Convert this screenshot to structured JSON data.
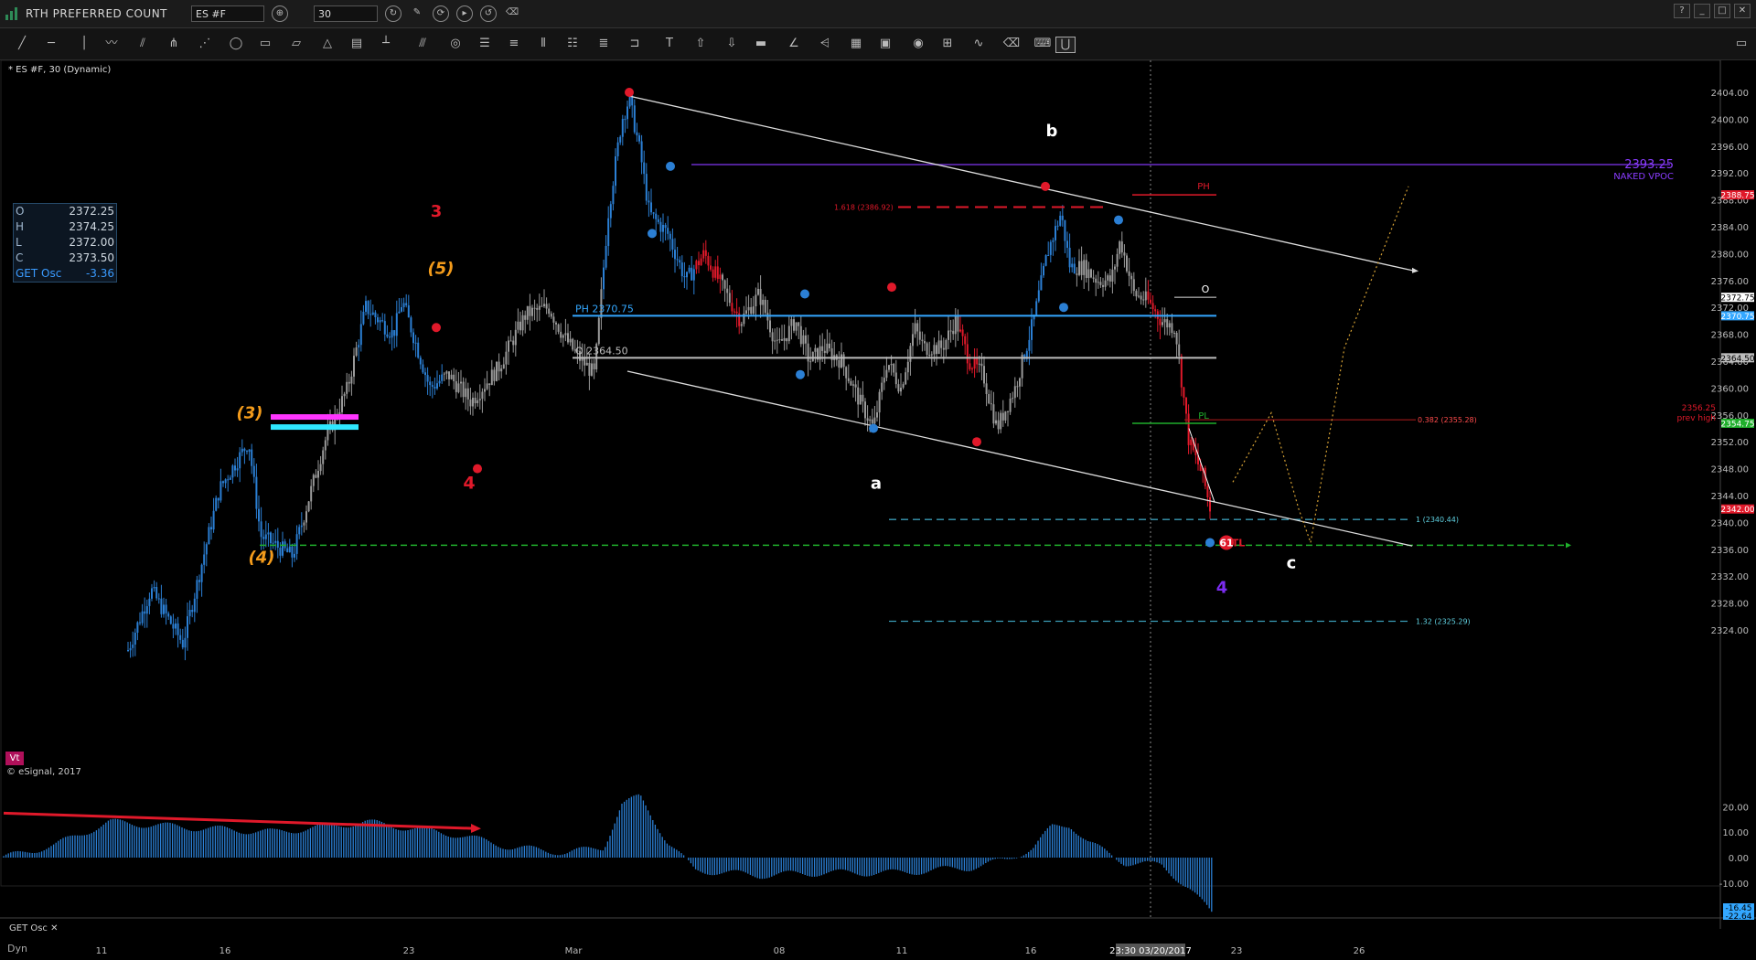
{
  "window": {
    "title": "RTH  PREFERRED COUNT",
    "symbol": "ES #F",
    "interval": "30",
    "controls": [
      "?",
      "_",
      "□",
      "✕"
    ]
  },
  "chart_label": "* ES #F, 30 (Dynamic)",
  "ohlc_box": {
    "rows": [
      {
        "k": "O",
        "v": "2372.25"
      },
      {
        "k": "H",
        "v": "2374.25"
      },
      {
        "k": "L",
        "v": "2372.00"
      },
      {
        "k": "C",
        "v": "2373.50"
      },
      {
        "k": "GET Osc",
        "v": "-3.36"
      }
    ]
  },
  "footer": {
    "copyright": "© eSignal, 2017",
    "vt": "Vt",
    "osc_tab": "GET Osc",
    "dyn": "Dyn"
  },
  "colors": {
    "bull": "#2b7fd4",
    "bear": "#e0192a",
    "neutral": "#9a9a9a",
    "wave_orange": "#f39b1b",
    "wave_purple": "#7b2cf0",
    "level_blue": "#33a7ff",
    "level_gray": "#bdbdbd",
    "vpoc_purple": "#6a2cc9",
    "green": "#1fae2b"
  },
  "chart_data": {
    "type": "candlestick",
    "price_axis": {
      "ylim": [
        2320,
        2406
      ],
      "ticks": [
        "2404.00",
        "2400.00",
        "2396.00",
        "2392.00",
        "2388.00",
        "2384.00",
        "2380.00",
        "2376.00",
        "2372.00",
        "2368.00",
        "2364.00",
        "2360.00",
        "2356.00",
        "2352.00",
        "2348.00",
        "2344.00",
        "2340.00",
        "2336.00",
        "2332.00",
        "2328.00",
        "2324.00"
      ],
      "price_tags": [
        {
          "label": "2388.75",
          "value": 2388.75,
          "color": "#e0192a"
        },
        {
          "label": "2372.75",
          "value": 2373.5,
          "color": "#ffffff"
        },
        {
          "label": "2370.75",
          "value": 2370.75,
          "color": "#33a7ff"
        },
        {
          "label": "2364.50",
          "value": 2364.5,
          "color": "#bdbdbd"
        },
        {
          "label": "2354.75",
          "value": 2354.75,
          "color": "#1fae2b"
        },
        {
          "label": "2342.00",
          "value": 2342.0,
          "color": "#e0192a"
        }
      ]
    },
    "osc_axis": {
      "ticks": [
        "20.00",
        "10.00",
        "0.00",
        "-10.00"
      ],
      "tags": [
        "-16.45",
        "-22.64"
      ]
    },
    "time_axis": {
      "ticks": [
        "11",
        "16",
        "23",
        "Mar",
        "08",
        "11",
        "16",
        "23",
        "26"
      ],
      "cursor_label": "23:30 03/20/2017"
    },
    "levels": [
      {
        "label": "PH 2370.75",
        "value": 2370.75
      },
      {
        "label": "O 2364.50",
        "value": 2364.5
      },
      {
        "label": "2393.25",
        "value": 2393.25
      },
      {
        "label": "NAKED VPOC",
        "value": 2393.25
      },
      {
        "label": "1.618 (2386.92)",
        "value": 2386.92
      },
      {
        "label": "0.382 (2355.28)",
        "value": 2355.28
      },
      {
        "label": "2356.25",
        "value": 2356.25
      },
      {
        "label": "prev high",
        "value": 2356.25
      },
      {
        "label": "1 (2340.44)",
        "value": 2340.44
      },
      {
        "label": "1.32 (2325.29)",
        "value": 2325.29
      },
      {
        "label": "PH",
        "value": 2388.75
      },
      {
        "label": "PL",
        "value": 2354.75
      },
      {
        "label": "O",
        "value": 2373.5
      },
      {
        "label": "PTL",
        "value": 2337.0
      }
    ],
    "wave_labels": [
      {
        "text": "3",
        "color": "purple"
      },
      {
        "text": "b",
        "color": "white"
      },
      {
        "text": "3",
        "color": "red"
      },
      {
        "text": "(5)",
        "color": "orange"
      },
      {
        "text": "(3)",
        "color": "orange"
      },
      {
        "text": "(4)",
        "color": "orange"
      },
      {
        "text": "4",
        "color": "red"
      },
      {
        "text": "a",
        "color": "white"
      },
      {
        "text": "c",
        "color": "white"
      },
      {
        "text": "4",
        "color": "purple"
      },
      {
        "text": "61",
        "color": "red"
      }
    ]
  }
}
